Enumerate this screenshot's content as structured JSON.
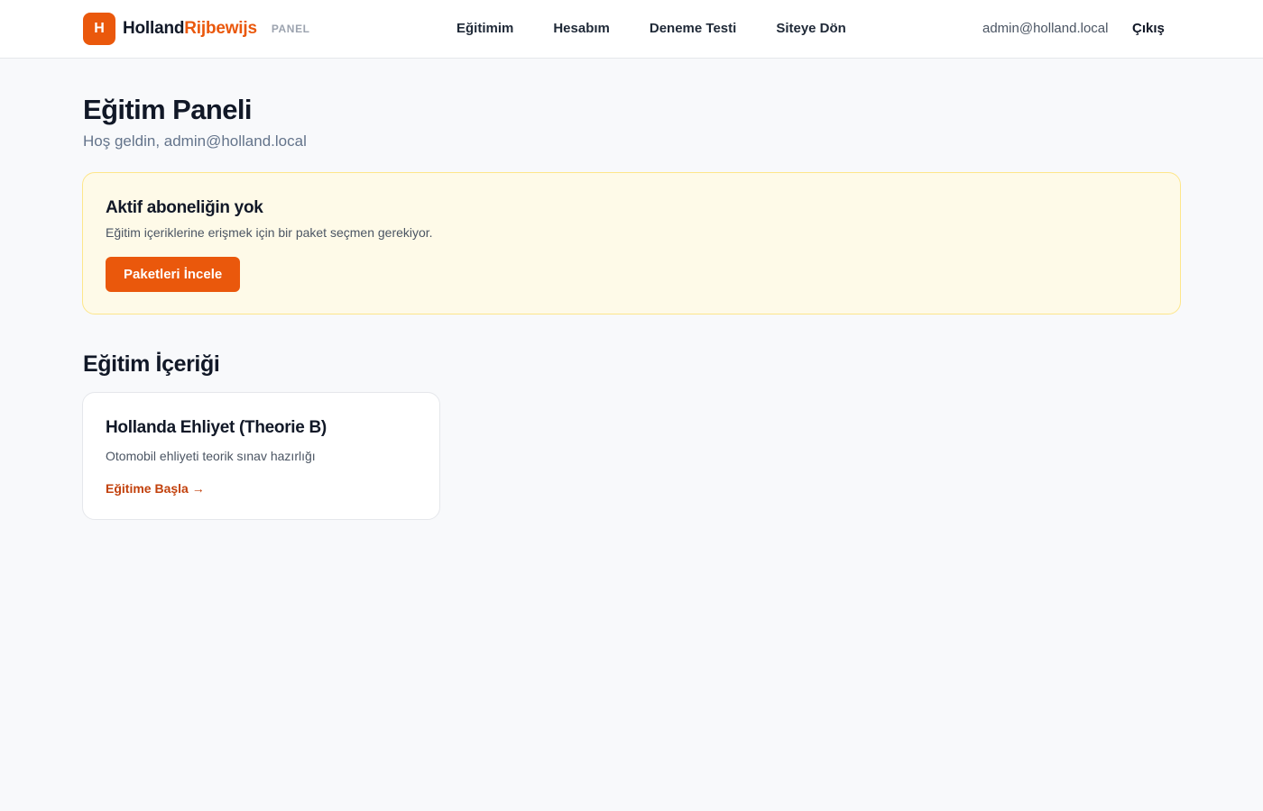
{
  "brand": {
    "mark": "H",
    "name_primary": "Holland",
    "name_accent": "Rijbewijs",
    "tag": "PANEL"
  },
  "nav": {
    "items": [
      {
        "label": "Eğitimim"
      },
      {
        "label": "Hesabım"
      },
      {
        "label": "Deneme Testi"
      },
      {
        "label": "Siteye Dön"
      }
    ]
  },
  "user": {
    "email": "admin@holland.local",
    "logout_label": "Çıkış"
  },
  "page": {
    "title": "Eğitim Paneli",
    "subtitle": "Hoş geldin, admin@holland.local"
  },
  "alert": {
    "title": "Aktif aboneliğin yok",
    "text": "Eğitim içeriklerine erişmek için bir paket seçmen gerekiyor.",
    "button_label": "Paketleri İncele"
  },
  "section": {
    "title": "Eğitim İçeriği"
  },
  "courses": [
    {
      "title": "Hollanda Ehliyet (Theorie B)",
      "description": "Otomobil ehliyeti teorik sınav hazırlığı",
      "link_label": "Eğitime Başla →"
    }
  ],
  "colors": {
    "accent": "#ea580c",
    "accent_dark": "#c2410c",
    "alert_bg": "#fefae8",
    "alert_border": "#fde68a",
    "page_bg": "#f8f9fb"
  }
}
